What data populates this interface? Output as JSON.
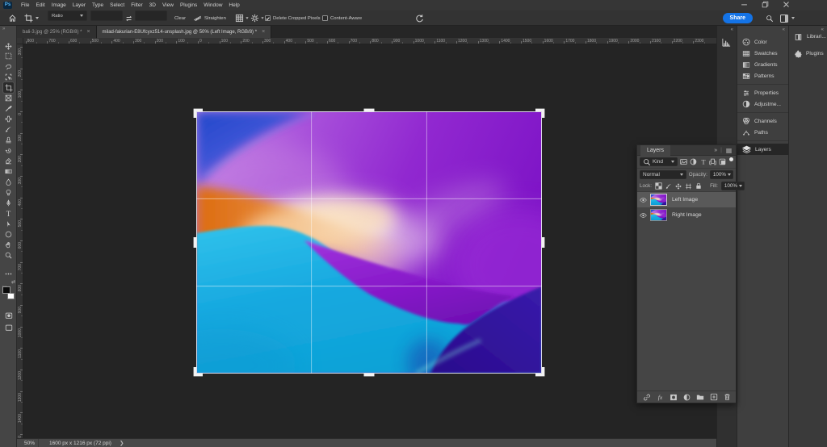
{
  "window": {
    "controls": [
      {
        "name": "minimize",
        "icon": "winmin"
      },
      {
        "name": "restore",
        "icon": "winrestore"
      },
      {
        "name": "close",
        "icon": "winclose"
      }
    ]
  },
  "menubar": {
    "logo": "Ps",
    "items": [
      "File",
      "Edit",
      "Image",
      "Layer",
      "Type",
      "Select",
      "Filter",
      "3D",
      "View",
      "Plugins",
      "Window",
      "Help"
    ]
  },
  "options_bar": {
    "home_icon": "home",
    "tool_icon": "croptool",
    "ratio_value": "Ratio",
    "width_value": "",
    "height_value": "",
    "swap_icon": "swap",
    "clear_label": "Clear",
    "straighten_icon": "straighten",
    "straighten_label": "Straighten",
    "grid_overlay_icon": "gridov",
    "settings_icon": "gear",
    "delete_cropped_pixels": {
      "label": "Delete Cropped Pixels",
      "checked": true
    },
    "content_aware": {
      "label": "Content-Aware",
      "checked": false
    },
    "reset_icon": "reset",
    "share_label": "Share",
    "search_icon": "search",
    "workspace_icon": "workspace"
  },
  "glyphs": {
    "tab_close": "×",
    "dock_collapse": "«",
    "toolbar_expand": "»",
    "panel_collapse": "»",
    "separator": "|"
  },
  "colors": {
    "accent_blue": "#1473e6",
    "ps_logo_blue": "#55b5f5",
    "selected_layer_row": "#595959"
  },
  "tabs": [
    {
      "label": "bali-3.jpg @ 25% (RGB/8) *",
      "active": false
    },
    {
      "label": "milad-fakurian-E8Ufcyxz514-unsplash.jpg @ 50% (Left Image, RGB/8) *",
      "active": true
    }
  ],
  "toolbar": {
    "tools": [
      {
        "name": "move",
        "icon": "move"
      },
      {
        "name": "marquee",
        "icon": "marquee"
      },
      {
        "name": "lasso",
        "icon": "lasso"
      },
      {
        "name": "object-selection",
        "icon": "objsel"
      },
      {
        "name": "crop",
        "icon": "crop",
        "selected": true
      },
      {
        "name": "frame",
        "icon": "frame"
      },
      {
        "name": "eyedropper",
        "icon": "eyedropper"
      },
      {
        "name": "healing-brush",
        "icon": "healing"
      },
      {
        "name": "brush",
        "icon": "brush"
      },
      {
        "name": "clone-stamp",
        "icon": "stamp"
      },
      {
        "name": "history-brush",
        "icon": "history"
      },
      {
        "name": "eraser",
        "icon": "eraser"
      },
      {
        "name": "gradient",
        "icon": "gradient"
      },
      {
        "name": "blur",
        "icon": "blur"
      },
      {
        "name": "dodge",
        "icon": "dodge"
      },
      {
        "name": "pen",
        "icon": "pen"
      },
      {
        "name": "type",
        "icon": "type"
      },
      {
        "name": "path-selection",
        "icon": "pathsel"
      },
      {
        "name": "shape",
        "icon": "shape"
      },
      {
        "name": "hand",
        "icon": "hand"
      },
      {
        "name": "zoom",
        "icon": "zoom"
      }
    ]
  },
  "rulers": {
    "h_labels": [
      "800",
      "700",
      "600",
      "500",
      "400",
      "300",
      "200",
      "100",
      "0",
      "100",
      "200",
      "300",
      "400",
      "500",
      "600",
      "700",
      "800",
      "900",
      "1000",
      "1100",
      "1200",
      "1300",
      "1400",
      "1500",
      "1600",
      "1700",
      "1800",
      "1900",
      "2000",
      "2100",
      "2200",
      "2300"
    ],
    "v_labels": [
      "300",
      "200",
      "100",
      "0",
      "100",
      "200",
      "300",
      "400",
      "500",
      "600",
      "700",
      "800",
      "900",
      "1000",
      "1100",
      "1200",
      "1300",
      "1400",
      "1500"
    ]
  },
  "status_bar": {
    "zoom": "50%",
    "doc_info": "1600 px x 1216 px (72 ppi)",
    "arrow": "❯"
  },
  "right_dock": {
    "collapsed_icons": [
      {
        "name": "histogram-icon",
        "icon": "histogram"
      }
    ],
    "panel_groups": [
      [
        {
          "label": "Color",
          "icon": "color"
        },
        {
          "label": "Swatches",
          "icon": "swatches"
        },
        {
          "label": "Gradients",
          "icon": "gradients"
        },
        {
          "label": "Patterns",
          "icon": "patterns"
        }
      ],
      [
        {
          "label": "Properties",
          "icon": "properties"
        },
        {
          "label": "Adjustme...",
          "icon": "adjustments"
        }
      ],
      [
        {
          "label": "Channels",
          "icon": "channels"
        },
        {
          "label": "Paths",
          "icon": "paths"
        }
      ],
      [
        {
          "label": "Layers",
          "icon": "layers",
          "selected": true
        }
      ]
    ],
    "right_items": [
      {
        "label": "Librari...",
        "icon": "libraries"
      },
      {
        "label": "Plugins",
        "icon": "plugins"
      }
    ]
  },
  "layers_panel": {
    "title": "Layers",
    "search_icon": "search",
    "kind_value": "Kind",
    "filter_icons": [
      {
        "name": "filter-image-icon",
        "icon": "fimage"
      },
      {
        "name": "filter-adjustment-icon",
        "icon": "fadj"
      },
      {
        "name": "filter-type-icon",
        "icon": "ftype"
      },
      {
        "name": "filter-shape-icon",
        "icon": "fshape"
      },
      {
        "name": "filter-smart-object-icon",
        "icon": "fsmart"
      }
    ],
    "lock_icons": [
      {
        "name": "lock-transparent-icon",
        "icon": "checker"
      },
      {
        "name": "lock-paint-icon",
        "icon": "brushsm"
      },
      {
        "name": "lock-position-icon",
        "icon": "movesm"
      },
      {
        "name": "lock-artboard-icon",
        "icon": "artboard"
      },
      {
        "name": "lock-all-icon",
        "icon": "lock"
      }
    ],
    "footer_icons": [
      {
        "name": "link-layers-icon",
        "icon": "link"
      },
      {
        "name": "layer-effects-icon",
        "icon": "fx"
      },
      {
        "name": "add-mask-icon",
        "icon": "mask"
      },
      {
        "name": "adjustment-layer-icon",
        "icon": "adjcircle"
      },
      {
        "name": "new-group-icon",
        "icon": "folder"
      },
      {
        "name": "new-layer-icon",
        "icon": "newlayer"
      },
      {
        "name": "delete-layer-icon",
        "icon": "trash"
      }
    ],
    "blend_mode": "Normal",
    "opacity_label": "Opacity:",
    "opacity_value": "100%",
    "lock_label": "Lock:",
    "fill_label": "Fill:",
    "fill_value": "100%",
    "layers": [
      {
        "name": "Left Image",
        "selected": true
      },
      {
        "name": "Right Image",
        "selected": false
      }
    ]
  }
}
